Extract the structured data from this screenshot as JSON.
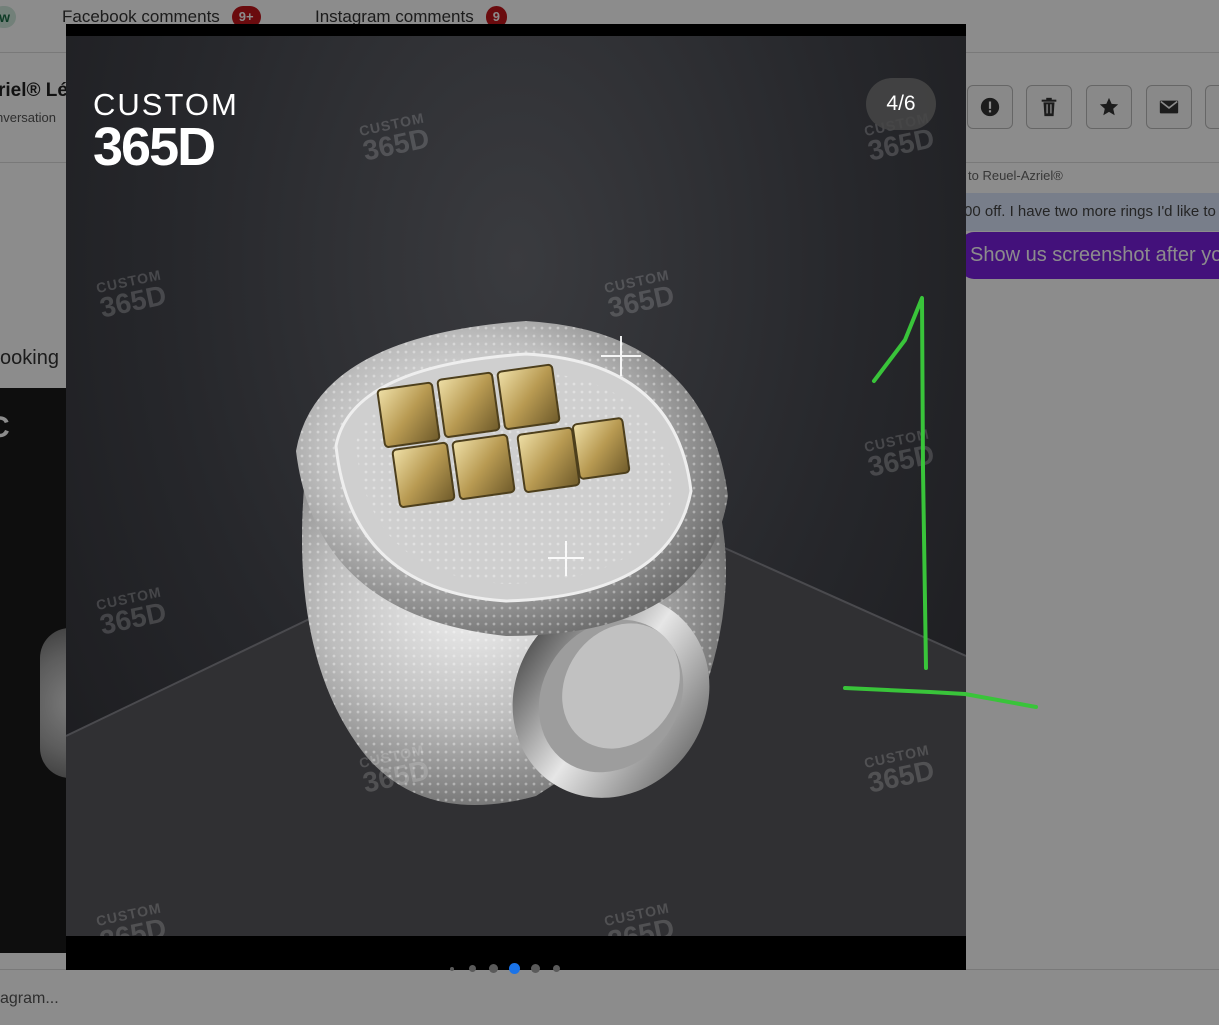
{
  "header": {
    "tab_stub": "w",
    "tabs": [
      {
        "label": "Facebook comments",
        "badge": "9+"
      },
      {
        "label": "Instagram comments",
        "badge": "9"
      }
    ]
  },
  "conversation": {
    "name": "riel® Lé",
    "subtitle": "nversation",
    "actions": [
      {
        "icon": "alert-icon"
      },
      {
        "icon": "trash-icon"
      },
      {
        "icon": "star-icon"
      },
      {
        "icon": "mail-icon"
      }
    ]
  },
  "messages": {
    "reply_note": "to Reuel-Azriel®",
    "quoted_text": "00 off. I have two more rings I'd like to",
    "bubble_text": "Show us screenshot after yo",
    "left_text": "ooking",
    "left_image_logo": "C"
  },
  "composer": {
    "placeholder": "agram..."
  },
  "viewer": {
    "counter": "4/6",
    "logo_top": "CUSTOM",
    "logo_bottom": "365D",
    "watermark_top": "CUSTOM",
    "watermark_bottom": "365D",
    "dots_total": 6,
    "dots_active_index": 3
  },
  "colors": {
    "badge": "#c1141b",
    "bubble": "#7b1fe0",
    "quoted_bg": "#dbe6fb",
    "active_dot": "#1a73e8",
    "annotation": "#39c43a"
  },
  "annotation": {
    "type": "hand-drawn",
    "glyph": "1"
  }
}
